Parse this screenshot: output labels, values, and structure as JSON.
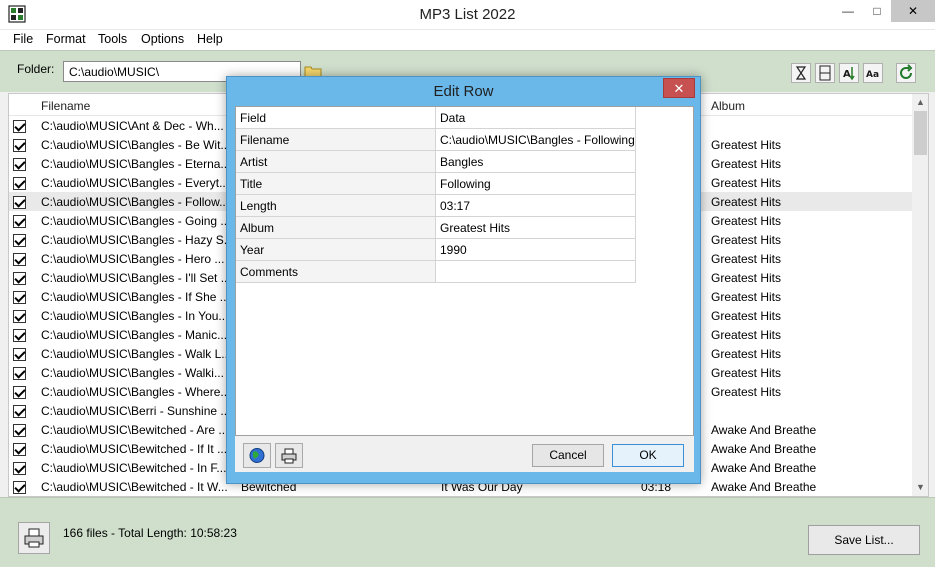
{
  "window": {
    "title": "MP3 List 2022"
  },
  "menu": [
    "File",
    "Format",
    "Tools",
    "Options",
    "Help"
  ],
  "toolbar": {
    "folder_label": "Folder:",
    "folder_value": "C:\\audio\\MUSIC\\"
  },
  "list": {
    "headers": {
      "filename": "Filename",
      "album": "Album"
    },
    "rows": [
      {
        "file": "C:\\audio\\MUSIC\\Ant & Dec - Wh...",
        "artist": "",
        "title": "",
        "length": "",
        "album": ""
      },
      {
        "file": "C:\\audio\\MUSIC\\Bangles - Be Wit...",
        "artist": "",
        "title": "",
        "length": "",
        "album": "Greatest Hits"
      },
      {
        "file": "C:\\audio\\MUSIC\\Bangles - Eterna...",
        "artist": "",
        "title": "",
        "length": "",
        "album": "Greatest Hits"
      },
      {
        "file": "C:\\audio\\MUSIC\\Bangles - Everyt...",
        "artist": "",
        "title": "",
        "length": "",
        "album": "Greatest Hits"
      },
      {
        "file": "C:\\audio\\MUSIC\\Bangles - Follow...",
        "artist": "",
        "title": "",
        "length": "",
        "album": "Greatest Hits"
      },
      {
        "file": "C:\\audio\\MUSIC\\Bangles - Going ...",
        "artist": "",
        "title": "",
        "length": "",
        "album": "Greatest Hits"
      },
      {
        "file": "C:\\audio\\MUSIC\\Bangles - Hazy S...",
        "artist": "",
        "title": "",
        "length": "",
        "album": "Greatest Hits"
      },
      {
        "file": "C:\\audio\\MUSIC\\Bangles - Hero ...",
        "artist": "",
        "title": "",
        "length": "",
        "album": "Greatest Hits"
      },
      {
        "file": "C:\\audio\\MUSIC\\Bangles - I'll Set ...",
        "artist": "",
        "title": "",
        "length": "",
        "album": "Greatest Hits"
      },
      {
        "file": "C:\\audio\\MUSIC\\Bangles - If She ...",
        "artist": "",
        "title": "",
        "length": "",
        "album": "Greatest Hits"
      },
      {
        "file": "C:\\audio\\MUSIC\\Bangles - In You...",
        "artist": "",
        "title": "",
        "length": "",
        "album": "Greatest Hits"
      },
      {
        "file": "C:\\audio\\MUSIC\\Bangles - Manic...",
        "artist": "",
        "title": "",
        "length": "",
        "album": "Greatest Hits"
      },
      {
        "file": "C:\\audio\\MUSIC\\Bangles - Walk L...",
        "artist": "",
        "title": "",
        "length": "",
        "album": "Greatest Hits"
      },
      {
        "file": "C:\\audio\\MUSIC\\Bangles - Walki...",
        "artist": "",
        "title": "",
        "length": "",
        "album": "Greatest Hits"
      },
      {
        "file": "C:\\audio\\MUSIC\\Bangles - Where...",
        "artist": "",
        "title": "",
        "length": "",
        "album": "Greatest Hits"
      },
      {
        "file": "C:\\audio\\MUSIC\\Berri - Sunshine ...",
        "artist": "",
        "title": "",
        "length": "",
        "album": ""
      },
      {
        "file": "C:\\audio\\MUSIC\\Bewitched - Are ...",
        "artist": "",
        "title": "",
        "length": "",
        "album": "Awake And Breathe"
      },
      {
        "file": "C:\\audio\\MUSIC\\Bewitched - If It ...",
        "artist": "",
        "title": "",
        "length": "",
        "album": "Awake And Breathe"
      },
      {
        "file": "C:\\audio\\MUSIC\\Bewitched - In F...",
        "artist": "",
        "title": "",
        "length": "",
        "album": "Awake And Breathe"
      },
      {
        "file": "C:\\audio\\MUSIC\\Bewitched - It W...",
        "artist": "Bewitched",
        "title": "It Was Our Day",
        "length": "03:18",
        "album": "Awake And Breathe"
      }
    ]
  },
  "status": {
    "summary": "166 files - Total Length: 10:58:23",
    "save_label": "Save List..."
  },
  "dialog": {
    "title": "Edit Row",
    "close_glyph": "✕",
    "header": {
      "field": "Field",
      "data": "Data"
    },
    "fields": [
      {
        "field": "Filename",
        "data": "C:\\audio\\MUSIC\\Bangles - Following"
      },
      {
        "field": "Artist",
        "data": "Bangles"
      },
      {
        "field": "Title",
        "data": "Following"
      },
      {
        "field": "Length",
        "data": "03:17"
      },
      {
        "field": "Album",
        "data": "Greatest Hits"
      },
      {
        "field": "Year",
        "data": "1990"
      },
      {
        "field": "Comments",
        "data": ""
      }
    ],
    "cancel_label": "Cancel",
    "ok_label": "OK"
  }
}
